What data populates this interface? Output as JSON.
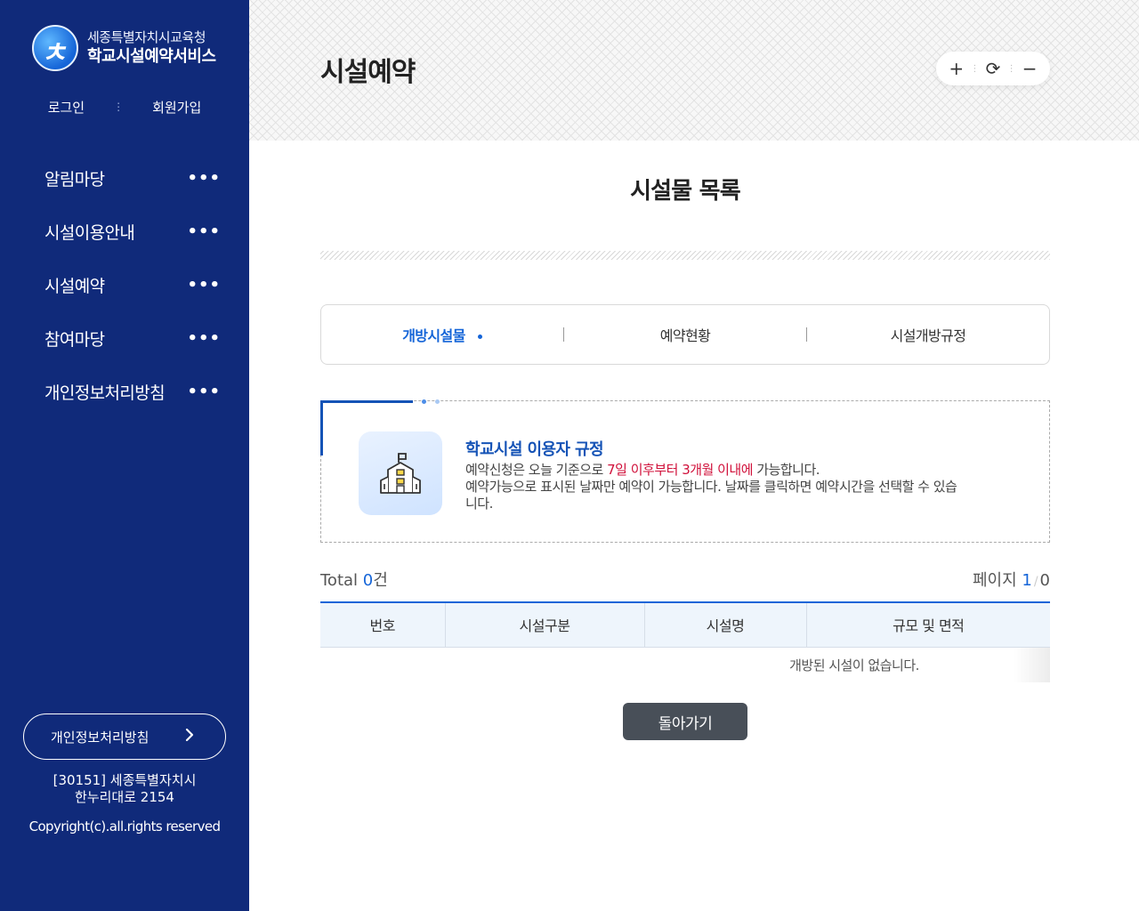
{
  "sidebar": {
    "logo": {
      "line1": "세종특별자치시교육청",
      "line2": "학교시설예약서비스"
    },
    "auth": {
      "login": "로그인",
      "separator": "⋮",
      "signup": "회원가입"
    },
    "nav": [
      {
        "label": "알림마당",
        "more": "•••"
      },
      {
        "label": "시설이용안내",
        "more": "•••"
      },
      {
        "label": "시설예약",
        "more": "•••"
      },
      {
        "label": "참여마당",
        "more": "•••"
      },
      {
        "label": "개인정보처리방침",
        "more": "•••"
      }
    ],
    "privacy_button": {
      "label": "개인정보처리방침",
      "icon": "chevron-right-icon"
    },
    "address": {
      "line1": "[30151] 세종특별자치시",
      "line2": "한누리대로 2154"
    },
    "copyright": "Copyright(c).all.rights reserved"
  },
  "header": {
    "title": "시설예약",
    "tools": {
      "zoom_in": "+",
      "refresh": "⟳",
      "zoom_out": "−",
      "sep": "⋮"
    }
  },
  "main": {
    "section_title": "시설물 목록",
    "tabs": [
      {
        "label": "개방시설물",
        "active": true
      },
      {
        "label": "예약현황",
        "active": false
      },
      {
        "label": "시설개방규정",
        "active": false
      }
    ],
    "notice": {
      "title": "학교시설 이용자 규정",
      "line1_prefix": "예약신청은 오늘 기준으로 ",
      "line1_highlight": "7일 이후부터 3개월 이내에",
      "line1_suffix": " 가능합니다.",
      "line2": "예약가능으로 표시된 날짜만 예약이 가능합니다. 날짜를 클릭하면 예약시간을 선택할 수 있습",
      "line3": "니다."
    },
    "total": {
      "prefix": "Total ",
      "count": "0",
      "suffix": "건"
    },
    "page": {
      "prefix": "페이지 ",
      "current": "1",
      "separator": "/",
      "total": "0"
    },
    "table": {
      "columns": [
        "번호",
        "시설구분",
        "시설명",
        "규모 및 면적"
      ],
      "empty_message": "개방된 시설이 없습니다."
    },
    "back_button": "돌아가기"
  },
  "colors": {
    "sidebar_bg": "#102a7a",
    "accent": "#1565d8",
    "highlight": "#d0103a",
    "button_dark": "#484f58"
  }
}
